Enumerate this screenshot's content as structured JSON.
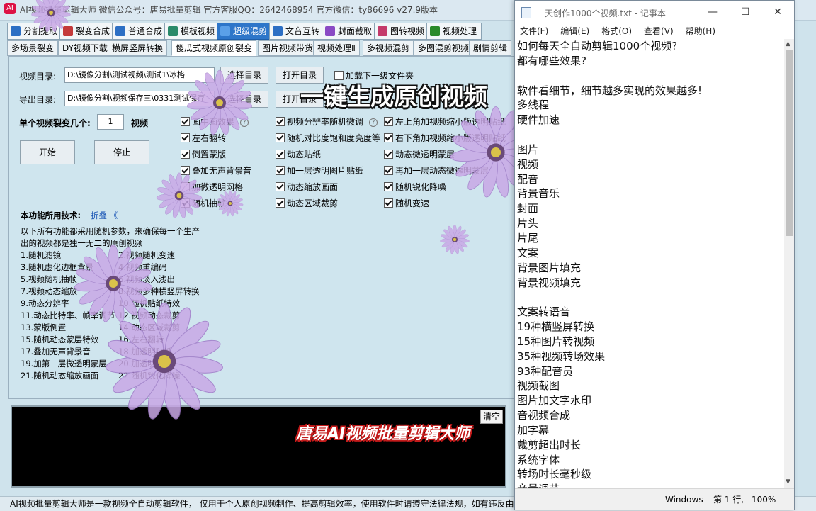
{
  "app": {
    "title": "AI视频批量剪辑大师   微信公众号：唐易批量剪辑   官方客服QQ：2642468954   官方微信：ty86696   v27.9版本",
    "tabs_top": [
      {
        "label": "分割提取",
        "icon": "split-icon",
        "color": "#2c6fc4"
      },
      {
        "label": "裂变合成",
        "icon": "merge-icon",
        "color": "#c43a3a"
      },
      {
        "label": "普通合成",
        "icon": "play-icon",
        "color": "#2c6fc4"
      },
      {
        "label": "模板视频",
        "icon": "template-icon",
        "color": "#2a8a6a"
      },
      {
        "label": "超级混剪",
        "icon": "mix-icon",
        "color": "#ffffff"
      },
      {
        "label": "文音互转",
        "icon": "voice-icon",
        "color": "#2c6fc4"
      },
      {
        "label": "封面截取",
        "icon": "cover-icon",
        "color": "#8a4ac4"
      },
      {
        "label": "图转视频",
        "icon": "image-video-icon",
        "color": "#c43a6a"
      },
      {
        "label": "视频处理",
        "icon": "video-process-icon",
        "color": "#2a8a2a"
      }
    ],
    "tabs_sub": [
      "多场景裂变",
      "DY视频下载",
      "横屏竖屏转换",
      "傻瓜式视频原创裂变",
      "图片视频带货",
      "视频处理Ⅱ",
      "多视频混剪",
      "多图混剪视频",
      "剧情剪辑"
    ],
    "video_dir_label": "视频目录:",
    "video_dir_value": "D:\\镜像分割\\测试视频\\测试1\\冰格",
    "export_dir_label": "导出目录:",
    "export_dir_value": "D:\\镜像分割\\视频保存三\\0331测试保存",
    "select_dir_btn": "选择目录",
    "open_dir_btn": "打开目录",
    "load_subfolder_label": "加载下一级文件夹",
    "per_video_label": "单个视频裂变几个:",
    "per_video_value": "1",
    "per_video_unit": "视频",
    "start_btn": "开始",
    "stop_btn": "停止",
    "options_col1": [
      {
        "label": "画中画效果",
        "checked": true,
        "help": true
      },
      {
        "label": "左右翻转",
        "checked": true,
        "help": false
      },
      {
        "label": "倒置蒙版",
        "checked": true,
        "help": false
      },
      {
        "label": "叠加无声背景音",
        "checked": true,
        "help": false
      },
      {
        "label": "加微透明网格",
        "checked": false,
        "help": false
      },
      {
        "label": "随机抽帧",
        "checked": true,
        "help": false
      }
    ],
    "options_col2": [
      {
        "label": "视频分辨率随机微调",
        "checked": true,
        "help": true
      },
      {
        "label": "随机对比度饱和度亮度等",
        "checked": true,
        "help": false
      },
      {
        "label": "动态贴纸",
        "checked": true,
        "help": false
      },
      {
        "label": "加一层透明图片贴纸",
        "checked": true,
        "help": false
      },
      {
        "label": "动态缩放画面",
        "checked": true,
        "help": false
      },
      {
        "label": "动态区域裁剪",
        "checked": true,
        "help": false
      }
    ],
    "options_col3": [
      {
        "label": "左上角加视频缩小版透明贴纸",
        "checked": true
      },
      {
        "label": "右下角加视频缩小版透明贴纸",
        "checked": true
      },
      {
        "label": "动态微透明蒙层",
        "checked": true
      },
      {
        "label": "再加一层动态微透明蒙层",
        "checked": true
      },
      {
        "label": "随机锐化降噪",
        "checked": true
      },
      {
        "label": "随机变速",
        "checked": true
      }
    ],
    "tech_label": "本功能所用技术:",
    "tech_fold": "折叠 《",
    "tech_intro": [
      "以下所有功能都采用随机参数，来确保每一个生产",
      "出的视频都是独一无二的原创视频"
    ],
    "tech_items": [
      [
        "1.随机滤镜",
        "2.视频随机变速"
      ],
      [
        "3.随机虚化边框背景",
        "4.视频重编码"
      ],
      [
        "5.视频随机抽帧",
        "6.视频淡入浅出"
      ],
      [
        "7.视频动态缩放",
        "8.视频多种横竖屏转换"
      ],
      [
        "9.动态分辨率",
        "10.随机贴纸特效"
      ],
      [
        "11.动态比特率、帧率调节",
        "12.视频动态裁剪"
      ],
      [
        "13.蒙版倒置",
        "14.动态区域裁剪"
      ],
      [
        "15.随机动态蒙层特效",
        "16.左右翻转"
      ],
      [
        "17.叠加无声背景音",
        "18.加透明贴纸"
      ],
      [
        "19.加第二层微透明蒙层",
        "20.加透明网格"
      ],
      [
        "21.随机动态缩放画面",
        "22.随机锐化降噪"
      ]
    ],
    "clear_btn": "清空",
    "status_bar": "AI视频批量剪辑大师是一款视频全自动剪辑软件，  仅用于个人原创视频制作、提高剪辑效率，使用软件时请遵守法律法规，如有违反由使用者自行承担全部责任!",
    "caption_main": "一键生成原创视频",
    "caption_brand": "唐易AI视频批量剪辑大师"
  },
  "notepad": {
    "title": "一天创作1000个视频.txt - 记事本",
    "menu": [
      "文件(F)",
      "编辑(E)",
      "格式(O)",
      "查看(V)",
      "帮助(H)"
    ],
    "lines": [
      "如何每天全自动剪辑1000个视频?",
      "都有哪些效果?",
      "",
      "软件看细节，细节越多实现的效果越多!",
      "多线程",
      "硬件加速",
      "",
      "图片",
      "视频",
      "配音",
      "背景音乐",
      "封面",
      "片头",
      "片尾",
      "文案",
      "背景图片填充",
      "背景视频填充",
      "",
      "文案转语音",
      "19种横竖屏转换",
      "15种图片转视频",
      "35种视频转场效果",
      "93种配音员",
      "视频截图",
      "图片加文字水印",
      "音视频合成",
      "加字幕",
      "裁剪超出时长",
      "系统字体",
      "转场时长毫秒级",
      "音量调节"
    ],
    "status": {
      "encoding": "Windows",
      "position": "第 1 行,",
      "zoom": "100%"
    }
  }
}
